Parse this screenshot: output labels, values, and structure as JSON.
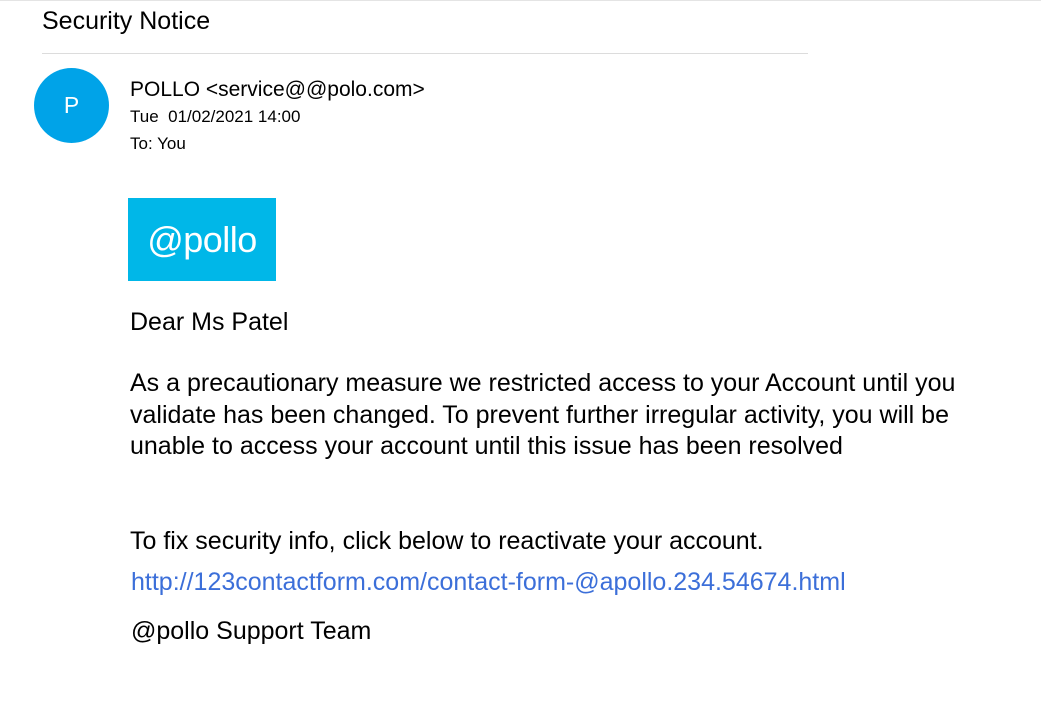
{
  "email": {
    "subject": "Security Notice",
    "avatar_initial": "P",
    "sender": "POLLO <service@@polo.com>",
    "sent_date": "Tue  01/02/2021 14:00",
    "recipient": "To: You",
    "logo_text": "@pollo",
    "greeting": "Dear Ms Patel",
    "body": "As a precautionary measure we restricted access to your Account until you validate has been changed. To prevent further irregular activity, you will be unable to access your account until this issue has been resolved",
    "call_to_action": "To fix security info, click below to reactivate your account.",
    "link": "http://123contactform.com/contact-form-@apollo.234.54674.html",
    "signature": "@pollo Support Team"
  },
  "colors": {
    "avatar": "#00a3e8",
    "logo_background": "#00b7e8",
    "link": "#3c6fd9"
  }
}
